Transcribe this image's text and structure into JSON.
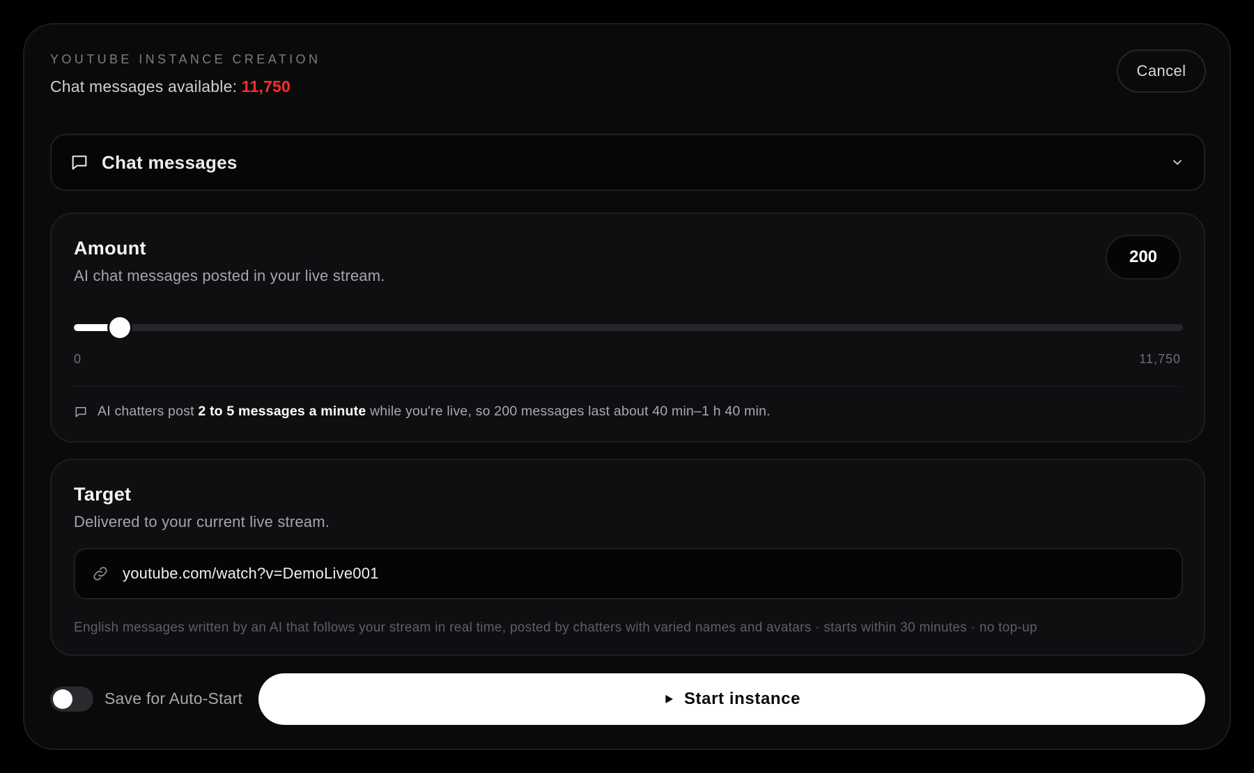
{
  "header": {
    "eyebrow": "YOUTUBE INSTANCE CREATION",
    "available_label": "Chat messages available:",
    "available_count": "11,750",
    "cancel_label": "Cancel"
  },
  "service_select": {
    "icon": "chat-bubble-icon",
    "selected": "Chat messages"
  },
  "amount": {
    "title": "Amount",
    "subtitle": "AI chat messages posted in your live stream.",
    "value": "200",
    "slider": {
      "min": 0,
      "max": 11750,
      "value": 200,
      "min_label": "0",
      "max_label": "11,750"
    },
    "note": {
      "prefix": "AI chatters post",
      "bold": "2 to 5 messages a minute",
      "suffix": "while you're live, so 200 messages last about 40 min–1 h 40 min."
    }
  },
  "target": {
    "title": "Target",
    "subtitle": "Delivered to your current live stream.",
    "url_value": "youtube.com/watch?v=DemoLive001",
    "fineprint": "English messages written by an AI that follows your stream in real time, posted by chatters with varied names and avatars · starts within 30 minutes · no top-up"
  },
  "footer": {
    "toggle_label": "Save for Auto-Start",
    "toggle_on": false,
    "start_label": "Start instance"
  },
  "colors": {
    "accent_count": "#ff2a2a",
    "background": "#0a0a0b",
    "primary_button": "#ffffff"
  }
}
